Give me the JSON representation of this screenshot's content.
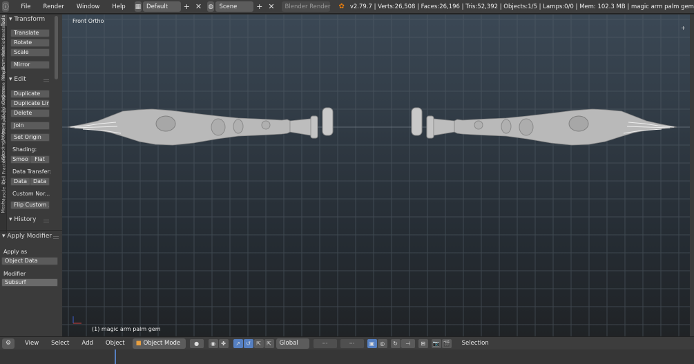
{
  "topbar": {
    "menus": [
      "File",
      "Render",
      "Window",
      "Help"
    ],
    "screen_layout": "Default",
    "scene": "Scene",
    "render_engine": "Blender Render",
    "stats": "v2.79.7 | Verts:26,508 | Faces:26,196 | Tris:52,392 | Objects:1/5 | Lamps:0/0 | Mem: 102.3 MB | magic arm palm gem"
  },
  "toolshelf": {
    "tabs": [
      "Tools",
      "Create",
      "Relations",
      "Animation",
      "Physics",
      "Grease Pencil",
      "Options",
      "3D Printing",
      "Retopology",
      "Ucupaint",
      "Shading/UVs",
      "Misc",
      "Cell Fracture",
      "BI",
      "Muscle",
      "Mesh"
    ],
    "transform_header": "Transform",
    "translate": "Translate",
    "rotate": "Rotate",
    "scale": "Scale",
    "mirror": "Mirror",
    "edit_header": "Edit",
    "duplicate": "Duplicate",
    "duplicate_linked": "Duplicate Lin...",
    "delete": "Delete",
    "join": "Join",
    "set_origin": "Set Origin",
    "shading_label": "Shading:",
    "smooth": "Smoo",
    "flat": "Flat",
    "data_transfer_label": "Data Transfer:",
    "data_1": "Data",
    "data_2": "Data",
    "custom_normals_label": "Custom Nor...",
    "flip_custom": "Flip Custom ...",
    "history_header": "History"
  },
  "operator_panel": {
    "header": "Apply Modifier",
    "apply_as_label": "Apply as",
    "apply_as_value": "Object Data",
    "modifier_label": "Modifier",
    "modifier_value": "Subsurf"
  },
  "viewport": {
    "view_name": "Front Ortho",
    "object_label": "(1) magic arm palm gem",
    "mesh_color": "#b9b9b9",
    "grid_color": "#55606a"
  },
  "bottombar": {
    "menus": [
      "View",
      "Select",
      "Add",
      "Object"
    ],
    "mode": "Object Mode",
    "orientation": "Global",
    "snap_label": "Selection"
  },
  "colors": {
    "accent": "#5680c2",
    "header_bg": "#3d3d3d",
    "panel_bg": "#3b3b3b"
  }
}
